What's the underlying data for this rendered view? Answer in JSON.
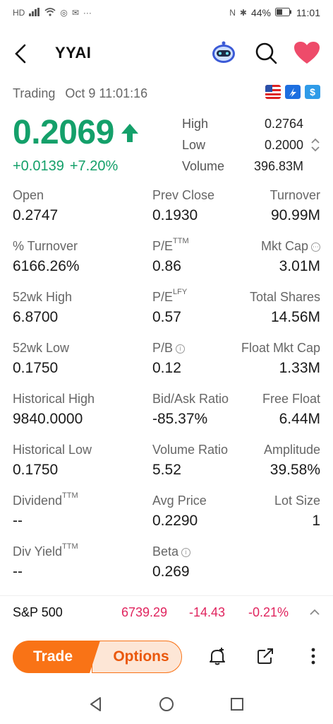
{
  "status_bar": {
    "left_icons": [
      "HD",
      "LTE",
      "4G"
    ],
    "battery": "44%",
    "time": "11:01"
  },
  "header": {
    "title": "YYAI"
  },
  "quote": {
    "status": "Trading",
    "timestamp": "Oct 9 11:01:16",
    "price": "0.2069",
    "change": "+0.0139",
    "change_pct": "+7.20%",
    "high_label": "High",
    "high": "0.2764",
    "low_label": "Low",
    "low": "0.2000",
    "volume_label": "Volume",
    "volume": "396.83M"
  },
  "stats": [
    [
      {
        "label": "Open",
        "value": "0.2747"
      },
      {
        "label": "Prev Close",
        "value": "0.1930"
      },
      {
        "label": "Turnover",
        "value": "90.99M"
      }
    ],
    [
      {
        "label": "% Turnover",
        "value": "6166.26%"
      },
      {
        "label": "P/E",
        "sup": "TTM",
        "value": "0.86"
      },
      {
        "label": "Mkt Cap",
        "value": "3.01M"
      }
    ],
    [
      {
        "label": "52wk High",
        "value": "6.8700"
      },
      {
        "label": "P/E",
        "sup": "LFY",
        "value": "0.57"
      },
      {
        "label": "Total Shares",
        "value": "14.56M"
      }
    ],
    [
      {
        "label": "52wk Low",
        "value": "0.1750"
      },
      {
        "label": "P/B",
        "value": "0.12"
      },
      {
        "label": "Float Mkt Cap",
        "value": "1.33M"
      }
    ],
    [
      {
        "label": "Historical High",
        "value": "9840.0000"
      },
      {
        "label": "Bid/Ask Ratio",
        "value": "-85.37%"
      },
      {
        "label": "Free Float",
        "value": "6.44M"
      }
    ],
    [
      {
        "label": "Historical Low",
        "value": "0.1750"
      },
      {
        "label": "Volume Ratio",
        "value": "5.52"
      },
      {
        "label": "Amplitude",
        "value": "39.58%"
      }
    ],
    [
      {
        "label": "Dividend",
        "sup": "TTM",
        "value": "--"
      },
      {
        "label": "Avg Price",
        "value": "0.2290"
      },
      {
        "label": "Lot Size",
        "value": "1"
      }
    ],
    [
      {
        "label": "Div Yield",
        "sup": "TTM",
        "value": "--"
      },
      {
        "label": "Beta",
        "value": "0.269"
      },
      {
        "label": "",
        "value": ""
      }
    ]
  ],
  "index": {
    "name": "S&P 500",
    "value": "6739.29",
    "change": "-14.43",
    "change_pct": "-0.21%"
  },
  "actions": {
    "trade_label": "Trade",
    "options_label": "Options"
  },
  "colors": {
    "up": "#14a06a",
    "down": "#e0245e",
    "accent": "#f97316"
  }
}
